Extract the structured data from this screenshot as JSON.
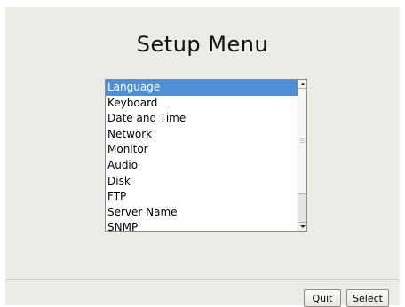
{
  "title": "Setup Menu",
  "menu": {
    "items": [
      {
        "label": "Language",
        "selected": true
      },
      {
        "label": "Keyboard",
        "selected": false
      },
      {
        "label": "Date and Time",
        "selected": false
      },
      {
        "label": "Network",
        "selected": false
      },
      {
        "label": "Monitor",
        "selected": false
      },
      {
        "label": "Audio",
        "selected": false
      },
      {
        "label": "Disk",
        "selected": false
      },
      {
        "label": "FTP",
        "selected": false
      },
      {
        "label": "Server Name",
        "selected": false
      },
      {
        "label": "SNMP",
        "selected": false
      }
    ]
  },
  "buttons": {
    "quit": "Quit",
    "select": "Select"
  },
  "colors": {
    "selection": "#4f8fd6",
    "window_bg": "#edebe6"
  }
}
